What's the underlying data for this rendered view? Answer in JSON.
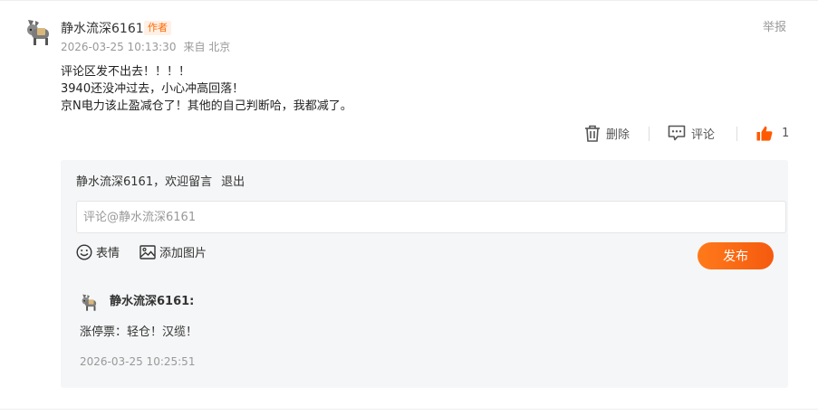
{
  "comment": {
    "author": "静水流深6161",
    "badge": "作者",
    "time": "2026-03-25 10:13:30",
    "location": "来自 北京",
    "report_label": "举报",
    "lines": [
      "评论区发不出去！！！！",
      "3940还没冲过去，小心冲高回落！",
      "京N电力该止盈减仓了！其他的自己判断哈，我都减了。"
    ],
    "actions": {
      "delete_label": "删除",
      "reply_label": "评论",
      "like_count": "1"
    }
  },
  "reply_box": {
    "welcome": "静水流深6161，欢迎留言",
    "logout_label": "退出",
    "input_placeholder": "评论@静水流深6161",
    "input_value": "",
    "emoji_label": "表情",
    "image_label": "添加图片",
    "publish_label": "发布"
  },
  "sub_reply": {
    "author": "静水流深6161:",
    "text": "涨停票：轻仓！汉缆！",
    "time": "2026-03-25 10:25:51"
  },
  "colors": {
    "accent": "#ff6a00",
    "like_icon": "#ff5a00",
    "muted_text": "#999999",
    "panel_bg": "#f5f6f7"
  },
  "icons": {
    "avatar": "donkey-avatar",
    "delete": "trash-icon",
    "reply": "comment-icon",
    "like": "thumbs-up-icon",
    "emoji": "smiley-icon",
    "image": "image-icon"
  }
}
